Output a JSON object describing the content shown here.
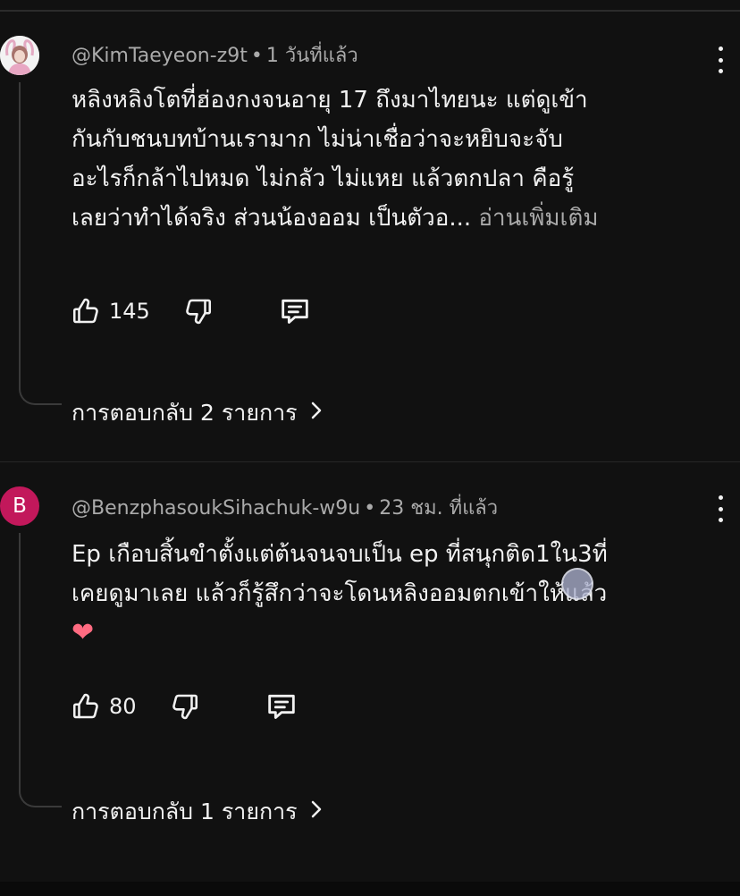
{
  "comments": [
    {
      "author": "@KimTaeyeon-z9t",
      "time": "1 วันที่แล้ว",
      "avatar": {
        "type": "photo"
      },
      "lines": [
        "หลิงหลิงโตที่ฮ่องกงจนอายุ 17 ถึงมาไทยนะ แต่ดูเข้า",
        "กันกับชนบทบ้านเรามาก ไม่น่าเชื่อว่าจะหยิบจะจับ",
        "อะไรก็กล้าไปหมด  ไม่กลัว ไม่แหย แล้วตกปลา คือรู้",
        "เลยว่าทำได้จริง   ส่วนน้องออม เป็นตัวอ..."
      ],
      "read_more": "อ่านเพิ่มเติม",
      "likes": "145",
      "replies": "การตอบกลับ 2 รายการ"
    },
    {
      "author": "@BenzphasoukSihachuk-w9u",
      "time": "23 ชม. ที่แล้ว",
      "avatar": {
        "type": "letter",
        "letter": "B",
        "color": "#c2185b"
      },
      "lines": [
        "Ep เกือบสิ้นขำตั้งแต่ต้นจนจบเป็น ep ที่สนุกติด1ใน3ที่",
        "เคยดูมาเลย แล้วก็รู้สึกว่าจะโดนหลิงออมตกเข้าให้แล้ว"
      ],
      "emoji": "❤",
      "likes": "80",
      "replies": "การตอบกลับ 1 รายการ"
    }
  ],
  "separator": "•",
  "icons": {
    "like": "thumb-up-icon",
    "dislike": "thumb-down-icon",
    "reply": "comment-icon",
    "more": "more-vert-icon",
    "chevron": "chevron-right-icon"
  },
  "colors": {
    "background": "#111111",
    "text": "#f1f1f1",
    "secondary_text": "#aaaaaa",
    "avatar_b": "#c2185b"
  }
}
